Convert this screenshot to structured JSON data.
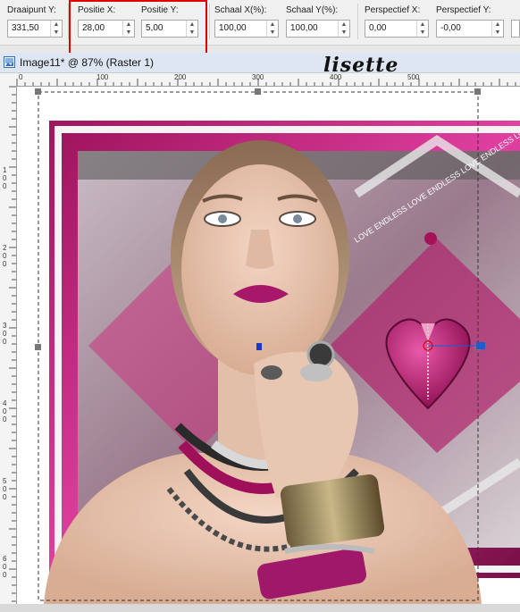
{
  "toolbar": {
    "fields": [
      {
        "label": "Draaipunt Y:",
        "value": "331,50"
      },
      {
        "label": "Positie X:",
        "value": "28,00"
      },
      {
        "label": "Positie Y:",
        "value": "5,00"
      },
      {
        "label": "Schaal X(%):",
        "value": "100,00"
      },
      {
        "label": "Schaal Y(%):",
        "value": "100,00"
      },
      {
        "label": "Perspectief X:",
        "value": "0,00"
      },
      {
        "label": "Perspectief Y:",
        "value": "-0,00"
      }
    ]
  },
  "window": {
    "title": "Image11* @  87% (Raster 1)"
  },
  "watermark": "lisette",
  "ruler_top": [
    "0",
    "100",
    "200",
    "300",
    "400",
    "500"
  ],
  "ruler_left": [
    "1 0 0",
    "2 0 0",
    "3 0 0",
    "4 0 0",
    "5 0 0",
    "6 0 0"
  ],
  "artwork": {
    "banner_text": "LOVE ENDLESS LOVE ENDLESS LOVE ENDLESS LOVE"
  },
  "colors": {
    "accent": "#c3207a",
    "dark_pink": "#6a1640",
    "highlight": "#e00000"
  }
}
